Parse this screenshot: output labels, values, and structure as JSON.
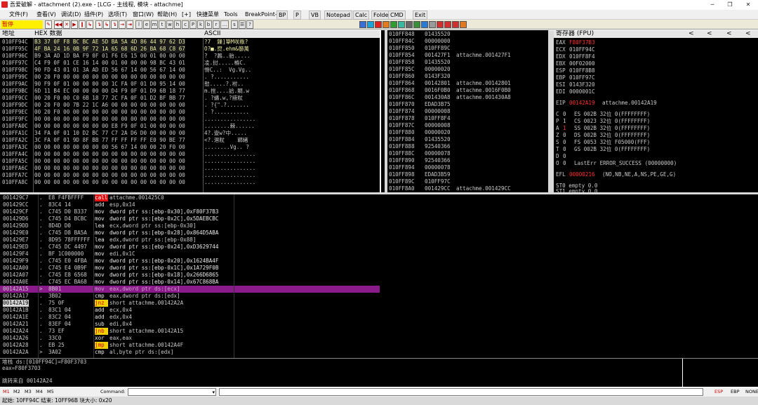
{
  "window": {
    "title": "吾爱破解 - attachment (2).exe - [LCG - 主线程, 模块 - attachme]",
    "minimize": "─",
    "restore": "❐",
    "close": "✕"
  },
  "menu": [
    "文件(F)",
    "查看(V)",
    "调试(D)",
    "插件(P)",
    "选项(T)",
    "窗口(W)",
    "帮助(H)",
    "[+]",
    "快捷菜单",
    "Tools",
    "BreakPoint->"
  ],
  "plugins": [
    "BP",
    "P",
    "VB",
    "Notepad",
    "Calc",
    "Folder",
    "CMD",
    "Exit"
  ],
  "toolbar": {
    "status": "暂停",
    "buttons": [
      "✎",
      "◀◀",
      "✕",
      "▶",
      "‖",
      "↳",
      "↴",
      "↳",
      "↴",
      "→",
      "⇥",
      "l",
      "e",
      "m",
      "t",
      "w",
      "h",
      "c",
      "P",
      "k",
      "b",
      "r",
      "...",
      "s",
      "☰",
      "?"
    ]
  },
  "dump": {
    "headers": [
      "地址",
      "HEX 数据",
      "ASCII"
    ],
    "rows": [
      {
        "addr": "010FF94C",
        "hex": "B3 37 0F F8 BC BC AE 5D BA 5A 4D 86 44 97 62 D3",
        "ascii": "?7  鏁]篫M咲梑?"
      },
      {
        "addr": "010FF95C",
        "hex": "4F BA 24 16 0B 9F 72 1A 65 68 6D 26 BA 68 C8 67",
        "ascii": "O?■.焤.ehm&篽萭"
      },
      {
        "addr": "010FF96C",
        "hex": "B9 3A AD 1D BA F9 0F 01 F6 E6 15 00 01 00 00 00",
        "ascii": "?  ?鶈..骀.....  "
      },
      {
        "addr": "010FF97C",
        "hex": "C4 F9 0F 01 CE 16 14 00 01 00 00 00 98 BC 43 01",
        "ascii": "凌.挝.....樤C."
      },
      {
        "addr": "010FF98C",
        "hex": "90 FD 43 01 01 3A AD ED 56 67 14 00 56 67 14 00",
        "ascii": "愲C..:  Vg.Vg.."
      },
      {
        "addr": "010FF99C",
        "hex": "00 20 F0 00 00 00 00 00 00 00 00 00 00 00 00 00",
        "ascii": ". ?..........."
      },
      {
        "addr": "010FF9AC",
        "hex": "90 F9 0F 01 00 00 00 00 1C FA 0F 01 D0 95 14 00",
        "ascii": "愸.....?.袝.."
      },
      {
        "addr": "010FF9BC",
        "hex": "6D 11 B4 EC 00 00 00 00 D4 F9 0F 01 D9 6B 18 77",
        "ascii": "m.挫....詥.賙.w"
      },
      {
        "addr": "010FF9CC",
        "hex": "00 20 F0 00 C0 6B 18 77 2C FA 0F 01 D2 BF BB 77",
        "ascii": ". ?纊.w,?掖粀"
      },
      {
        "addr": "010FF9DC",
        "hex": "00 20 F0 00 7B 22 1C A6 00 00 00 00 00 00 00 00",
        "ascii": ". ?{\".?......."
      },
      {
        "addr": "010FF9EC",
        "hex": "00 20 F0 00 00 00 00 00 00 00 00 00 00 00 00 00",
        "ascii": ". ?..........."
      },
      {
        "addr": "010FF9FC",
        "hex": "00 00 00 00 00 00 00 00 00 00 00 00 00 00 00 00",
        "ascii": "................"
      },
      {
        "addr": "010FFA0C",
        "hex": "00 00 00 00 00 00 00 00 E8 F9 0F 01 00 00 00 00",
        "ascii": "........棘......"
      },
      {
        "addr": "010FFA1C",
        "hex": "34 FA 0F 01 10 D2 BC 77 C7 2A D6 D0 00 00 00 00",
        "ascii": "4?.壹w?中....."
      },
      {
        "addr": "010FFA2C",
        "hex": "3C FA 0F 01 9D 8F BB 77 FF FF FF FF E0 90 BE 77",
        "ascii": "<?.潖粀    鄲緒"
      },
      {
        "addr": "010FFA3C",
        "hex": "00 00 00 00 00 00 00 00 56 67 14 00 00 20 F0 00",
        "ascii": "........Vg.. ?"
      },
      {
        "addr": "010FFA4C",
        "hex": "00 00 00 00 00 00 00 00 00 00 00 00 00 00 00 00",
        "ascii": "................"
      },
      {
        "addr": "010FFA5C",
        "hex": "00 00 00 00 00 00 00 00 00 00 00 00 00 00 00 00",
        "ascii": "................"
      },
      {
        "addr": "010FFA6C",
        "hex": "00 00 00 00 00 00 00 00 00 00 00 00 00 00 00 00",
        "ascii": "................"
      },
      {
        "addr": "010FFA7C",
        "hex": "00 00 00 00 00 00 00 00 00 00 00 00 00 00 00 00",
        "ascii": "................"
      },
      {
        "addr": "010FFA8C",
        "hex": "00 00 00 00 00 00 00 00 00 00 00 00 00 00 00 00",
        "ascii": "................"
      }
    ]
  },
  "stack": {
    "rows": [
      {
        "addr": "010FF848",
        "val": "01435520",
        "cmt": ""
      },
      {
        "addr": "010FF84C",
        "val": "00000000",
        "cmt": ""
      },
      {
        "addr": "010FF850",
        "val": "010FF89C",
        "cmt": ""
      },
      {
        "addr": "010FF854",
        "val": "001427F1",
        "cmt": "attachme.001427F1"
      },
      {
        "addr": "010FF858",
        "val": "01435520",
        "cmt": ""
      },
      {
        "addr": "010FF85C",
        "val": "00000020",
        "cmt": ""
      },
      {
        "addr": "010FF860",
        "val": "0143F320",
        "cmt": ""
      },
      {
        "addr": "010FF864",
        "val": "00142801",
        "cmt": "attachme.00142801"
      },
      {
        "addr": "010FF868",
        "val": "0016F0B0",
        "cmt": "attachme.0016F0B0"
      },
      {
        "addr": "010FF86C",
        "val": "001430A8",
        "cmt": "attachme.001430A8"
      },
      {
        "addr": "010FF870",
        "val": "EDAD3B75",
        "cmt": ""
      },
      {
        "addr": "010FF874",
        "val": "00000008",
        "cmt": ""
      },
      {
        "addr": "010FF878",
        "val": "010FF8F4",
        "cmt": ""
      },
      {
        "addr": "010FF87C",
        "val": "00000008",
        "cmt": ""
      },
      {
        "addr": "010FF880",
        "val": "00000020",
        "cmt": ""
      },
      {
        "addr": "010FF884",
        "val": "01435520",
        "cmt": ""
      },
      {
        "addr": "010FF888",
        "val": "92540366",
        "cmt": ""
      },
      {
        "addr": "010FF88C",
        "val": "00000078",
        "cmt": ""
      },
      {
        "addr": "010FF890",
        "val": "92540366",
        "cmt": ""
      },
      {
        "addr": "010FF894",
        "val": "00000078",
        "cmt": ""
      },
      {
        "addr": "010FF898",
        "val": "EDAD3B59",
        "cmt": ""
      },
      {
        "addr": "010FF89C",
        "val": "010FF97C",
        "cmt": ""
      },
      {
        "addr": "010FF8A0",
        "val": "001429CC",
        "cmt": "attachme.001429CC"
      }
    ]
  },
  "registers": {
    "header": "寄存器 (FPU)",
    "arrows": [
      "<",
      "<",
      "<",
      "<"
    ],
    "gp": [
      {
        "name": "EAX",
        "val": "F80F37B3"
      },
      {
        "name": "ECX",
        "val": "010FF94C"
      },
      {
        "name": "EDX",
        "val": "010FF8F4"
      },
      {
        "name": "EBX",
        "val": "00F02000"
      },
      {
        "name": "ESP",
        "val": "010FF8B8"
      },
      {
        "name": "EBP",
        "val": "010FF97C"
      },
      {
        "name": "ESI",
        "val": "0143F320"
      },
      {
        "name": "EDI",
        "val": "0000001C"
      }
    ],
    "eip": {
      "name": "EIP",
      "val": "00142A19",
      "cmt": "attachme.00142A19"
    },
    "flags": [
      {
        "f": "C",
        "v": "0",
        "seg": "ES 002B 32位 0(FFFFFFFF)",
        "red": false
      },
      {
        "f": "P",
        "v": "1",
        "seg": "CS 0023 32位 0(FFFFFFFF)",
        "red": false
      },
      {
        "f": "A",
        "v": "1",
        "seg": "SS 002B 32位 0(FFFFFFFF)",
        "red": true
      },
      {
        "f": "Z",
        "v": "0",
        "seg": "DS 002B 32位 0(FFFFFFFF)",
        "red": false
      },
      {
        "f": "S",
        "v": "0",
        "seg": "FS 0053 32位 F05000(FFF)",
        "red": false
      },
      {
        "f": "T",
        "v": "0",
        "seg": "GS 002B 32位 0(FFFFFFFF)",
        "red": false
      },
      {
        "f": "D",
        "v": "0",
        "seg": "",
        "red": false
      },
      {
        "f": "O",
        "v": "0",
        "seg": "LastErr ERROR_SUCCESS (00000000)",
        "red": false
      }
    ],
    "efl": {
      "name": "EFL",
      "val": "00000216",
      "cmt": "(NO,NB,NE,A,NS,PE,GE,G)"
    },
    "fpu": [
      "ST0 empty 0.0",
      "ST1 empty 0.0"
    ]
  },
  "disasm": {
    "rows": [
      {
        "addr": "001429C7",
        "mark": ".",
        "bytes": "E8 F4FBFFFF",
        "mnem": "call",
        "ops": "attachme.001425C0",
        "kind": "call"
      },
      {
        "addr": "001429CC",
        "mark": ".",
        "bytes": "83C4 14",
        "mnem": "add",
        "ops": "esp,0x14",
        "kind": "normal"
      },
      {
        "addr": "001429CF",
        "mark": ".",
        "bytes": "C745 D0 B337",
        "mnem": "mov",
        "ops": "dword ptr ss:[ebp-0x30],0xF80F37B3",
        "kind": "normal"
      },
      {
        "addr": "001429D6",
        "mark": ".",
        "bytes": "C745 D4 BCBC",
        "mnem": "mov",
        "ops": "dword ptr ss:[ebp-0x2C],0x5DAEBCBC",
        "kind": "normal"
      },
      {
        "addr": "001429DD",
        "mark": ".",
        "bytes": "8D4D D0",
        "mnem": "lea",
        "ops": "ecx,dword ptr ss:[ebp-0x30]",
        "kind": "normal"
      },
      {
        "addr": "001429E0",
        "mark": ".",
        "bytes": "C745 D8 BA5A",
        "mnem": "mov",
        "ops": "dword ptr ss:[ebp-0x28],0x864D5ABA",
        "kind": "normal"
      },
      {
        "addr": "001429E7",
        "mark": ".",
        "bytes": "8D95 78FFFFFF",
        "mnem": "lea",
        "ops": "edx,dword ptr ss:[ebp-0x88]",
        "kind": "normal"
      },
      {
        "addr": "001429ED",
        "mark": ".",
        "bytes": "C745 DC 4497",
        "mnem": "mov",
        "ops": "dword ptr ss:[ebp-0x24],0xD3629744",
        "kind": "normal"
      },
      {
        "addr": "001429F4",
        "mark": ".",
        "bytes": "BF 1C000000",
        "mnem": "mov",
        "ops": "edi,0x1C",
        "kind": "normal"
      },
      {
        "addr": "001429F9",
        "mark": ".",
        "bytes": "C745 E0 4FBA",
        "mnem": "mov",
        "ops": "dword ptr ss:[ebp-0x20],0x1624BA4F",
        "kind": "normal"
      },
      {
        "addr": "00142A00",
        "mark": ".",
        "bytes": "C745 E4 0B9F",
        "mnem": "mov",
        "ops": "dword ptr ss:[ebp-0x1C],0x1A729F0B",
        "kind": "normal"
      },
      {
        "addr": "00142A07",
        "mark": ".",
        "bytes": "C745 E8 6568",
        "mnem": "mov",
        "ops": "dword ptr ss:[ebp-0x18],0x266D6865",
        "kind": "normal"
      },
      {
        "addr": "00142A0E",
        "mark": ".",
        "bytes": "C745 EC BA68",
        "mnem": "mov",
        "ops": "dword ptr ss:[ebp-0x14],0x67C868BA",
        "kind": "normal"
      },
      {
        "addr": "00142A15",
        "mark": ">",
        "bytes": "8B01",
        "mnem": "mov",
        "ops": "eax,dword ptr ds:[ecx]",
        "kind": "selected"
      },
      {
        "addr": "00142A17",
        "mark": ".",
        "bytes": "3B02",
        "mnem": "cmp",
        "ops": "eax,dword ptr ds:[edx]",
        "kind": "normal"
      },
      {
        "addr": "00142A19",
        "mark": ".",
        "bytes": "75 0F",
        "mnem": "jnz",
        "ops": "short attachme.00142A2A",
        "kind": "jump",
        "eip": true
      },
      {
        "addr": "00142A1B",
        "mark": ".",
        "bytes": "83C1 04",
        "mnem": "add",
        "ops": "ecx,0x4",
        "kind": "normal"
      },
      {
        "addr": "00142A1E",
        "mark": ".",
        "bytes": "83C2 04",
        "mnem": "add",
        "ops": "edx,0x4",
        "kind": "normal"
      },
      {
        "addr": "00142A21",
        "mark": ".",
        "bytes": "83EF 04",
        "mnem": "sub",
        "ops": "edi,0x4",
        "kind": "normal"
      },
      {
        "addr": "00142A24",
        "mark": ".",
        "bytes": "73 EF",
        "mnem": "jnb",
        "ops": "short attachme.00142A15",
        "kind": "jump"
      },
      {
        "addr": "00142A26",
        "mark": ".",
        "bytes": "33C0",
        "mnem": "xor",
        "ops": "eax,eax",
        "kind": "normal"
      },
      {
        "addr": "00142A28",
        "mark": ".",
        "bytes": "EB 25",
        "mnem": "jmp",
        "ops": "short attachme.00142A4F",
        "kind": "jump"
      },
      {
        "addr": "00142A2A",
        "mark": ">",
        "bytes": "3A02",
        "mnem": "cmp",
        "ops": "al,byte ptr ds:[edx]",
        "kind": "normal"
      }
    ]
  },
  "info": {
    "lines": [
      "堆栈 ds:[010FF94C]=F80F3703",
      "eax=F80F3703",
      "",
      "跳转来自 00142A24"
    ]
  },
  "command": {
    "tabs": [
      "M1",
      "M2",
      "M3",
      "M4",
      "M5"
    ],
    "label": "Command:",
    "right": [
      "ESP",
      "EBP",
      "NONE"
    ]
  },
  "statusbar": {
    "text": "起始: 10FF94C  结束: 10FF96B  块大小: 0x20"
  }
}
